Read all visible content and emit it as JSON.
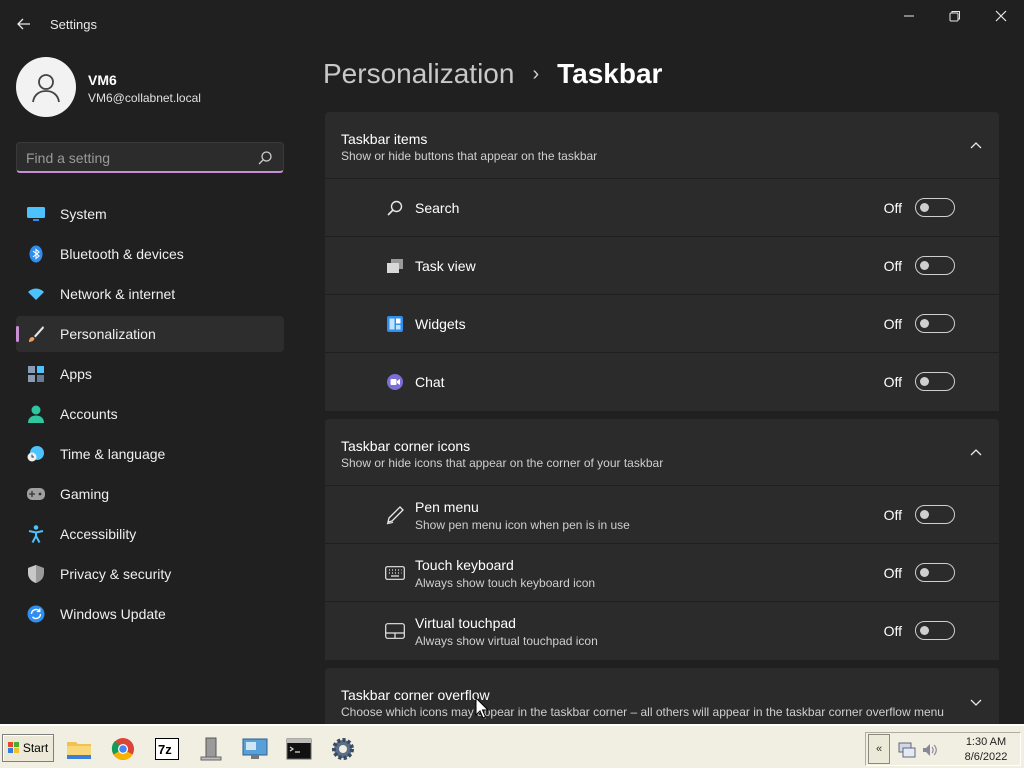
{
  "window": {
    "title": "Settings",
    "back_icon": "arrow-left-icon",
    "controls": [
      "minimize-icon",
      "restore-icon",
      "close-icon"
    ]
  },
  "profile": {
    "name": "VM6",
    "email": "VM6@collabnet.local"
  },
  "search": {
    "placeholder": "Find a setting",
    "value": ""
  },
  "sidebar": {
    "items": [
      {
        "label": "System",
        "icon": "monitor-icon",
        "color": "#4cc2ff"
      },
      {
        "label": "Bluetooth & devices",
        "icon": "bluetooth-icon",
        "color": "#2f8ef0"
      },
      {
        "label": "Network & internet",
        "icon": "wifi-icon",
        "color": "#4cc2ff"
      },
      {
        "label": "Personalization",
        "icon": "brush-icon",
        "color": "#f0a060",
        "active": true
      },
      {
        "label": "Apps",
        "icon": "apps-icon",
        "color": "#8a9bb5"
      },
      {
        "label": "Accounts",
        "icon": "person-icon",
        "color": "#2ec7a0"
      },
      {
        "label": "Time & language",
        "icon": "clock-globe-icon",
        "color": "#4cc2ff"
      },
      {
        "label": "Gaming",
        "icon": "gamepad-icon",
        "color": "#a0a0a0"
      },
      {
        "label": "Accessibility",
        "icon": "accessibility-icon",
        "color": "#4cc2ff"
      },
      {
        "label": "Privacy & security",
        "icon": "shield-icon",
        "color": "#9a9a9a"
      },
      {
        "label": "Windows Update",
        "icon": "update-icon",
        "color": "#2f8ef0"
      }
    ],
    "accent": "#c98fd6"
  },
  "breadcrumb": {
    "parent": "Personalization",
    "separator": "›",
    "current": "Taskbar"
  },
  "groups": {
    "items": {
      "title": "Taskbar items",
      "subtitle": "Show or hide buttons that appear on the taskbar",
      "rows": [
        {
          "label": "Search",
          "icon": "search-icon",
          "state": "Off"
        },
        {
          "label": "Task view",
          "icon": "task-view-icon",
          "state": "Off"
        },
        {
          "label": "Widgets",
          "icon": "widgets-icon",
          "state": "Off"
        },
        {
          "label": "Chat",
          "icon": "chat-icon",
          "state": "Off"
        }
      ]
    },
    "corner": {
      "title": "Taskbar corner icons",
      "subtitle": "Show or hide icons that appear on the corner of your taskbar",
      "rows": [
        {
          "label": "Pen menu",
          "sub": "Show pen menu icon when pen is in use",
          "icon": "pen-icon",
          "state": "Off"
        },
        {
          "label": "Touch keyboard",
          "sub": "Always show touch keyboard icon",
          "icon": "keyboard-icon",
          "state": "Off"
        },
        {
          "label": "Virtual touchpad",
          "sub": "Always show virtual touchpad icon",
          "icon": "touchpad-icon",
          "state": "Off"
        }
      ]
    },
    "overflow": {
      "title": "Taskbar corner overflow",
      "subtitle": "Choose which icons may appear in the taskbar corner – all others will appear in the taskbar corner overflow menu"
    }
  },
  "taskbar": {
    "start_label": "Start",
    "apps": [
      "file-explorer-icon",
      "chrome-icon",
      "7zip-icon",
      "server-icon",
      "remote-desktop-icon",
      "terminal-icon",
      "settings-gear-icon"
    ],
    "tray_expand": "«",
    "time": "1:30 AM",
    "date": "8/6/2022"
  }
}
